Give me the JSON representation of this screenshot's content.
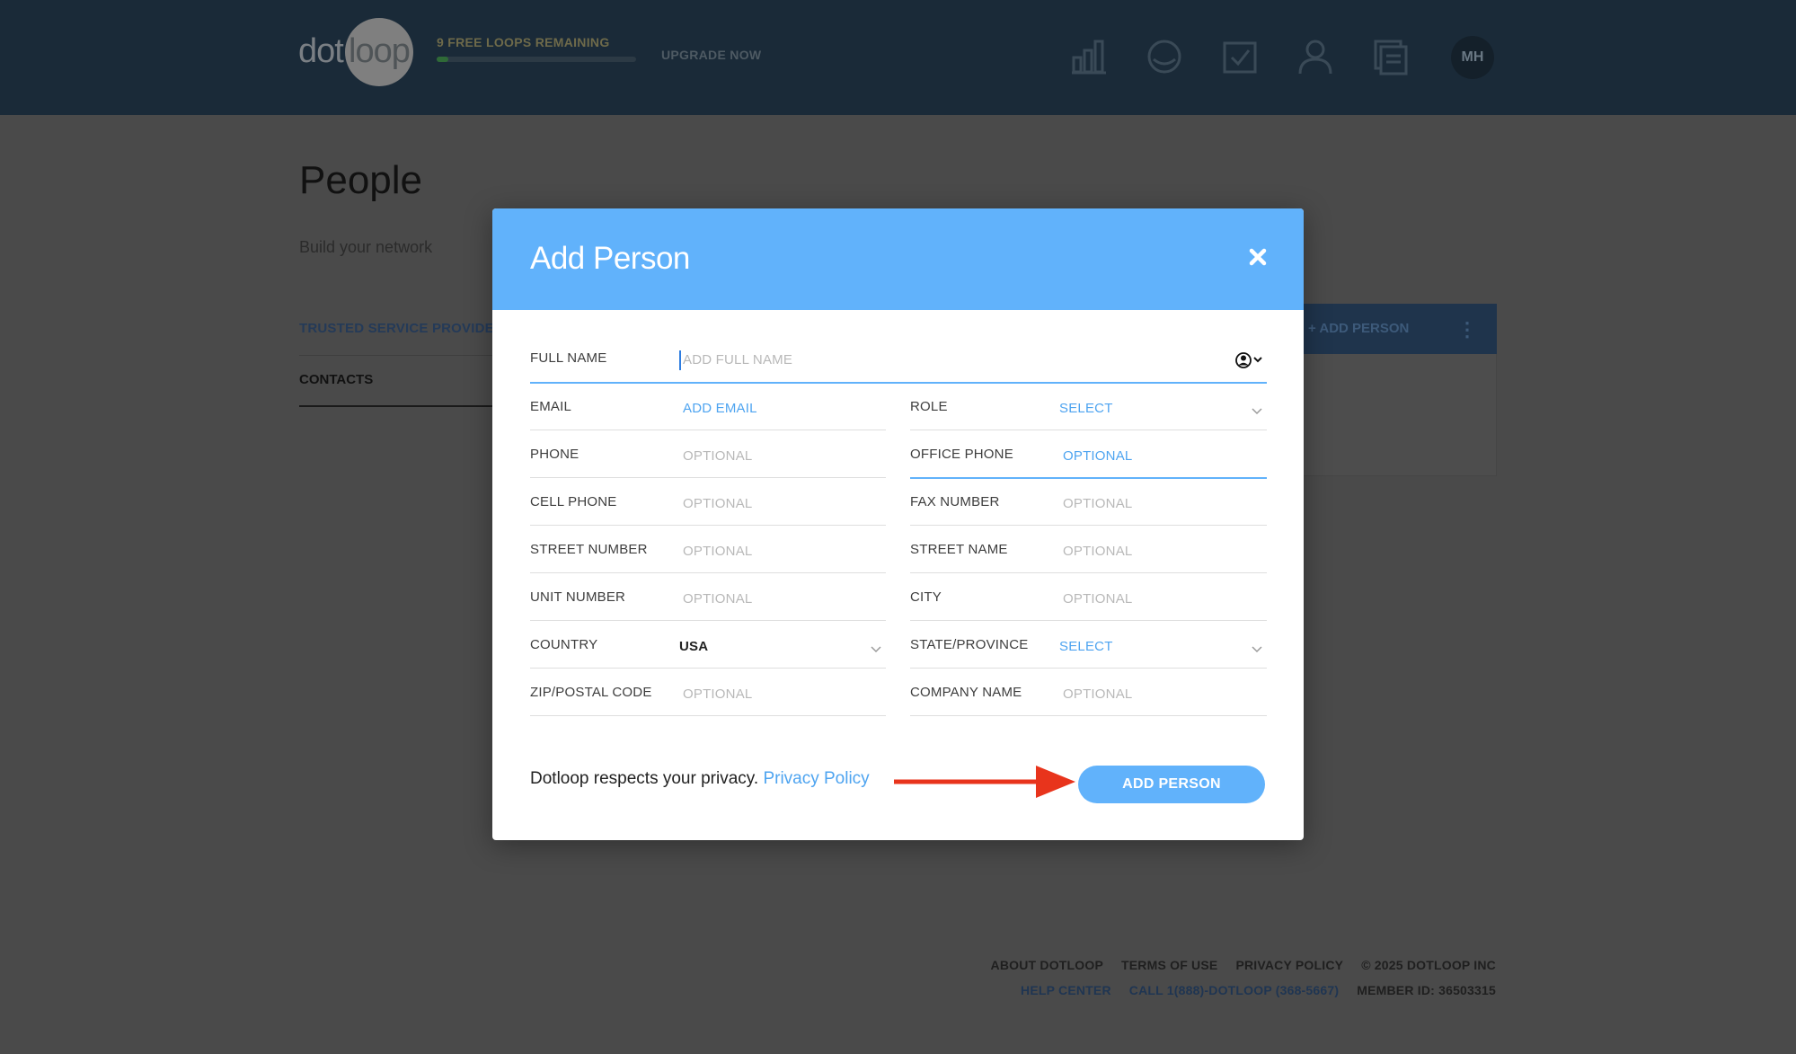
{
  "header": {
    "logo_dot": "dot",
    "logo_loop": "loop",
    "free_loops": "9 FREE LOOPS REMAINING",
    "free_loops_progress": 0.06,
    "upgrade": "UPGRADE NOW",
    "icons": [
      "bar-chart-icon",
      "loop-icon",
      "task-check-icon",
      "person-icon",
      "documents-icon"
    ],
    "avatar_initials": "MH"
  },
  "page": {
    "title": "People",
    "subtitle": "Build your network",
    "tabs": [
      "TRUSTED SERVICE PROVIDERS",
      "CONTACTS"
    ],
    "add_person_bg": "+ ADD PERSON"
  },
  "modal": {
    "title": "Add Person",
    "full_name_label": "FULL NAME",
    "full_name_placeholder": "ADD FULL NAME",
    "fields_left": [
      {
        "label": "EMAIL",
        "value": "ADD EMAIL"
      },
      {
        "label": "PHONE",
        "value": "OPTIONAL"
      },
      {
        "label": "CELL PHONE",
        "value": "OPTIONAL"
      },
      {
        "label": "STREET NUMBER",
        "value": "OPTIONAL"
      },
      {
        "label": "UNIT NUMBER",
        "value": "OPTIONAL"
      },
      {
        "label": "COUNTRY",
        "value": "USA"
      },
      {
        "label": "ZIP/POSTAL CODE",
        "value": "OPTIONAL"
      }
    ],
    "fields_right": [
      {
        "label": "ROLE",
        "value": "SELECT"
      },
      {
        "label": "OFFICE PHONE",
        "value": "OPTIONAL"
      },
      {
        "label": "FAX NUMBER",
        "value": "OPTIONAL"
      },
      {
        "label": "STREET NAME",
        "value": "OPTIONAL"
      },
      {
        "label": "CITY",
        "value": "OPTIONAL"
      },
      {
        "label": "STATE/PROVINCE",
        "value": "SELECT"
      },
      {
        "label": "COMPANY NAME",
        "value": "OPTIONAL"
      }
    ],
    "privacy_text": "Dotloop respects your privacy.",
    "privacy_link": "Privacy Policy",
    "add_button": "ADD PERSON"
  },
  "footer": {
    "links_row1": [
      "ABOUT DOTLOOP",
      "TERMS OF USE",
      "PRIVACY POLICY"
    ],
    "copyright": "© 2025 DOTLOOP INC",
    "help_center": "HELP CENTER",
    "call": "CALL 1(888)-DOTLOOP (368-5667)",
    "member_id": "MEMBER ID: 36503315"
  },
  "colors": {
    "accent": "#61b2fb",
    "link": "#4ea4f0",
    "annotation_arrow": "#e8341c"
  }
}
